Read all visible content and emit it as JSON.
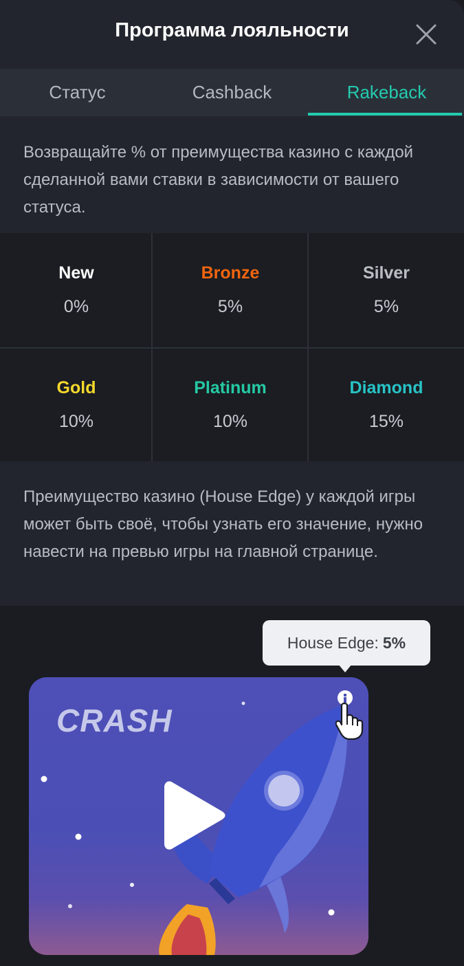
{
  "header": {
    "title": "Программа лояльности"
  },
  "tabs": [
    {
      "label": "Статус"
    },
    {
      "label": "Cashback"
    },
    {
      "label": "Rakeback"
    }
  ],
  "active_tab": "Rakeback",
  "intro": {
    "text": "Возвращайте % от преимущества казино с каждой сделанной вами ставки в зависимости от вашего статуса."
  },
  "tiers": [
    {
      "name": "New",
      "percent": "0%",
      "color": "#ffffff"
    },
    {
      "name": "Bronze",
      "percent": "5%",
      "color": "#f0650f"
    },
    {
      "name": "Silver",
      "percent": "5%",
      "color": "#b9bdc4"
    },
    {
      "name": "Gold",
      "percent": "10%",
      "color": "#f7d92c"
    },
    {
      "name": "Platinum",
      "percent": "10%",
      "color": "#25c9a4"
    },
    {
      "name": "Diamond",
      "percent": "15%",
      "color": "#27c3c7"
    }
  ],
  "note": {
    "text": "Преимущество казино (House Edge) у каждой игры может быть своё, чтобы узнать его значение, нужно навести на превью игры на главной странице."
  },
  "tooltip": {
    "label": "House Edge:",
    "value": "5%"
  },
  "game_preview": {
    "title": "CRASH",
    "icons": [
      "play-icon",
      "info-icon",
      "hand-pointer-icon",
      "rocket-illustration"
    ]
  },
  "colors": {
    "accent": "#23cbb0",
    "background": "#1a1c21",
    "panel": "#22252d"
  }
}
